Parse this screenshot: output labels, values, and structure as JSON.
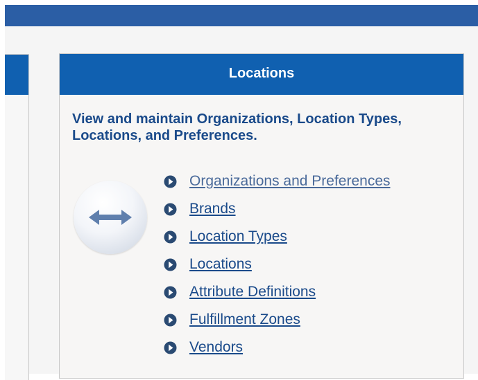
{
  "panel": {
    "title": "Locations",
    "description": "View and maintain Organizations, Location Types, Locations, and Preferences.",
    "icon": "bidirectional-arrow-icon",
    "links": [
      {
        "label": "Organizations and Preferences",
        "highlighted": true
      },
      {
        "label": "Brands"
      },
      {
        "label": "Location Types"
      },
      {
        "label": "Locations"
      },
      {
        "label": "Attribute Definitions"
      },
      {
        "label": "Fulfillment Zones"
      },
      {
        "label": "Vendors"
      }
    ]
  },
  "colors": {
    "header": "#1060b0",
    "top_bar": "#2b5ea5",
    "link": "#1a4a8a",
    "highlight": "#faf76a"
  }
}
